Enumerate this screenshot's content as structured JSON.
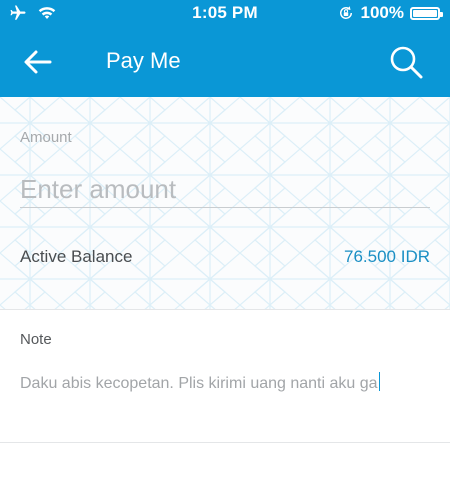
{
  "status_bar": {
    "time": "1:05 PM",
    "battery_percent": "100%",
    "icons": [
      "airplane-icon",
      "wifi-icon",
      "rotation-lock-icon",
      "battery-icon"
    ]
  },
  "app_bar": {
    "title": "Pay Me",
    "back_icon": "back-arrow-icon",
    "search_icon": "search-icon",
    "background_color": "#0a97d6"
  },
  "amount": {
    "label": "Amount",
    "placeholder": "Enter amount",
    "value": ""
  },
  "balance": {
    "label": "Active Balance",
    "value": "76.500 IDR",
    "value_color": "#1b8fc4"
  },
  "note": {
    "label": "Note",
    "value": "Daku abis kecopetan. Plis kirimi uang nanti aku ga"
  }
}
